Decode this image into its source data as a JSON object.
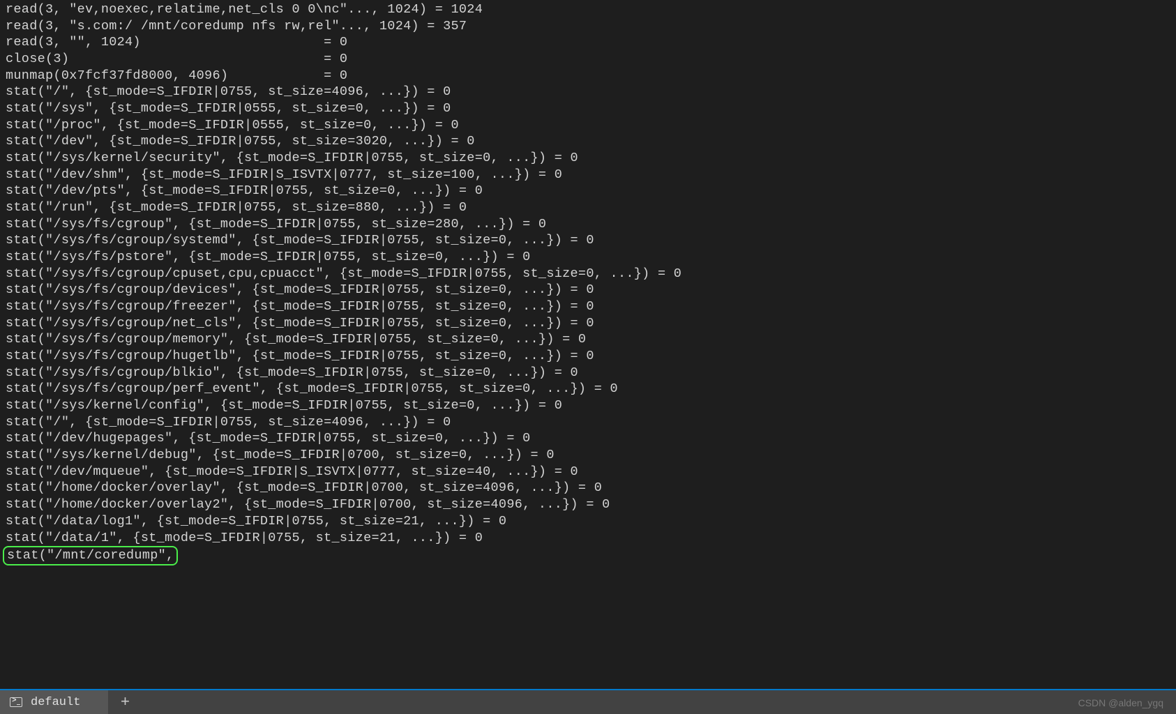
{
  "terminal": {
    "lines": [
      "read(3, \"ev,noexec,relatime,net_cls 0 0\\nc\"..., 1024) = 1024",
      "read(3, \"s.com:/ /mnt/coredump nfs rw,rel\"..., 1024) = 357",
      "read(3, \"\", 1024)                       = 0",
      "close(3)                                = 0",
      "munmap(0x7fcf37fd8000, 4096)            = 0",
      "stat(\"/\", {st_mode=S_IFDIR|0755, st_size=4096, ...}) = 0",
      "stat(\"/sys\", {st_mode=S_IFDIR|0555, st_size=0, ...}) = 0",
      "stat(\"/proc\", {st_mode=S_IFDIR|0555, st_size=0, ...}) = 0",
      "stat(\"/dev\", {st_mode=S_IFDIR|0755, st_size=3020, ...}) = 0",
      "stat(\"/sys/kernel/security\", {st_mode=S_IFDIR|0755, st_size=0, ...}) = 0",
      "stat(\"/dev/shm\", {st_mode=S_IFDIR|S_ISVTX|0777, st_size=100, ...}) = 0",
      "stat(\"/dev/pts\", {st_mode=S_IFDIR|0755, st_size=0, ...}) = 0",
      "stat(\"/run\", {st_mode=S_IFDIR|0755, st_size=880, ...}) = 0",
      "stat(\"/sys/fs/cgroup\", {st_mode=S_IFDIR|0755, st_size=280, ...}) = 0",
      "stat(\"/sys/fs/cgroup/systemd\", {st_mode=S_IFDIR|0755, st_size=0, ...}) = 0",
      "stat(\"/sys/fs/pstore\", {st_mode=S_IFDIR|0755, st_size=0, ...}) = 0",
      "stat(\"/sys/fs/cgroup/cpuset,cpu,cpuacct\", {st_mode=S_IFDIR|0755, st_size=0, ...}) = 0",
      "stat(\"/sys/fs/cgroup/devices\", {st_mode=S_IFDIR|0755, st_size=0, ...}) = 0",
      "stat(\"/sys/fs/cgroup/freezer\", {st_mode=S_IFDIR|0755, st_size=0, ...}) = 0",
      "stat(\"/sys/fs/cgroup/net_cls\", {st_mode=S_IFDIR|0755, st_size=0, ...}) = 0",
      "stat(\"/sys/fs/cgroup/memory\", {st_mode=S_IFDIR|0755, st_size=0, ...}) = 0",
      "stat(\"/sys/fs/cgroup/hugetlb\", {st_mode=S_IFDIR|0755, st_size=0, ...}) = 0",
      "stat(\"/sys/fs/cgroup/blkio\", {st_mode=S_IFDIR|0755, st_size=0, ...}) = 0",
      "stat(\"/sys/fs/cgroup/perf_event\", {st_mode=S_IFDIR|0755, st_size=0, ...}) = 0",
      "stat(\"/sys/kernel/config\", {st_mode=S_IFDIR|0755, st_size=0, ...}) = 0",
      "stat(\"/\", {st_mode=S_IFDIR|0755, st_size=4096, ...}) = 0",
      "stat(\"/dev/hugepages\", {st_mode=S_IFDIR|0755, st_size=0, ...}) = 0",
      "stat(\"/sys/kernel/debug\", {st_mode=S_IFDIR|0700, st_size=0, ...}) = 0",
      "stat(\"/dev/mqueue\", {st_mode=S_IFDIR|S_ISVTX|0777, st_size=40, ...}) = 0",
      "stat(\"/home/docker/overlay\", {st_mode=S_IFDIR|0700, st_size=4096, ...}) = 0",
      "stat(\"/home/docker/overlay2\", {st_mode=S_IFDIR|0700, st_size=4096, ...}) = 0",
      "stat(\"/data/log1\", {st_mode=S_IFDIR|0755, st_size=21, ...}) = 0"
    ],
    "highlighted_line_prefix": "stat(\"/data/1\", {st_mode=",
    "highlighted_line_suffix": "S_IFDIR|0755, st_size=21, ...}) = 0",
    "highlighted": "stat(\"/mnt/coredump\","
  },
  "tabbar": {
    "active_tab": "default",
    "new_tab_symbol": "+"
  },
  "watermark": "CSDN @alden_ygq"
}
